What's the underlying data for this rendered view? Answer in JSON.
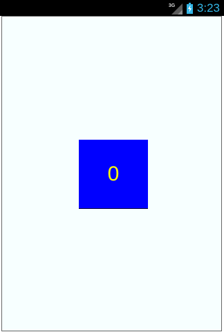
{
  "status_bar": {
    "network_type": "3G",
    "time": "3:23",
    "icons": [
      "signal-icon",
      "battery-charging-icon"
    ],
    "colors": {
      "background": "#000000",
      "clock": "#33b5e5"
    }
  },
  "main": {
    "counter": {
      "value": "0",
      "colors": {
        "box": "#0000ff",
        "text": "#ffff00"
      }
    },
    "colors": {
      "background": "#f7ffff"
    }
  }
}
